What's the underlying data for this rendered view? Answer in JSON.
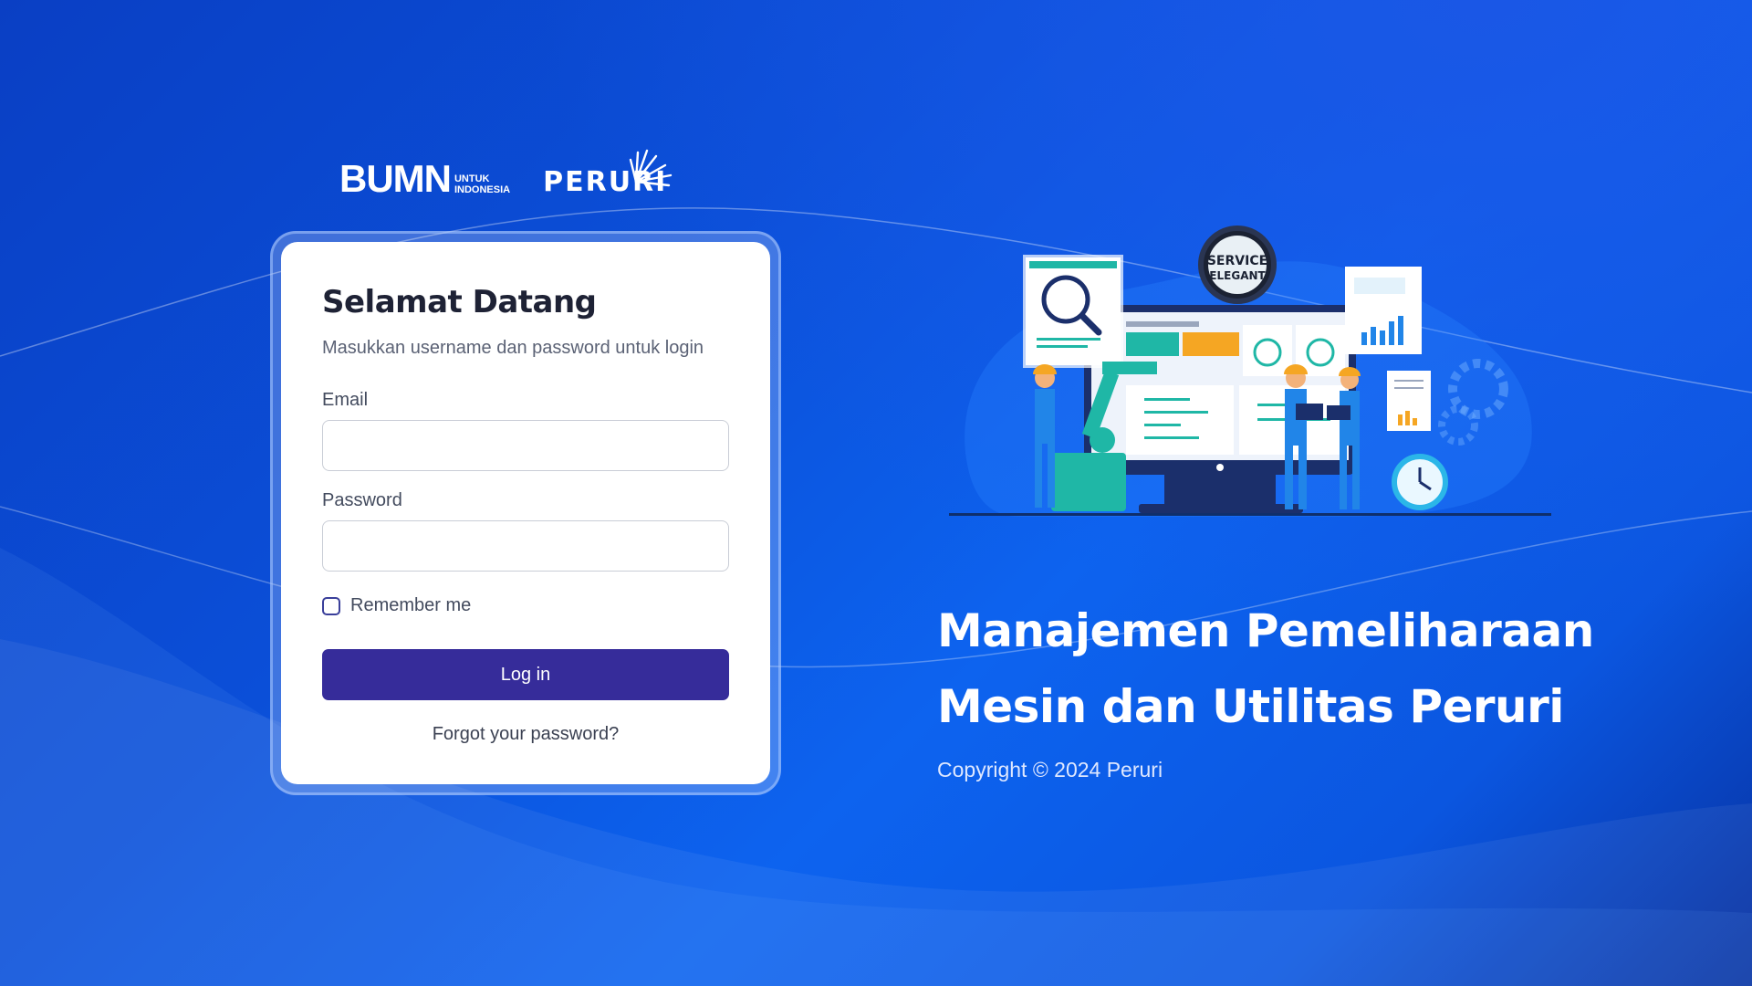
{
  "brand": {
    "bumn_logo": "BUMN",
    "bumn_sub_line1": "UNTUK",
    "bumn_sub_line2": "INDONESIA",
    "peruri_logo": "PERURI"
  },
  "login": {
    "title": "Selamat Datang",
    "subtitle": "Masukkan username dan password untuk login",
    "email_label": "Email",
    "email_value": "",
    "password_label": "Password",
    "password_value": "",
    "remember_label": "Remember me",
    "remember_checked": false,
    "login_button": "Log in",
    "forgot_link": "Forgot your password?"
  },
  "hero": {
    "headline_line1": "Manajemen Pemeliharaan",
    "headline_line2": "Mesin dan Utilitas Peruri",
    "copyright": "Copyright © 2024 Peruri",
    "badge_line1": "SERVICE",
    "badge_line2": "ELEGANT"
  },
  "colors": {
    "primary_button": "#362c9a",
    "background": "#0b4fd8",
    "accent_teal": "#1fb7a6",
    "accent_orange": "#f5a623"
  }
}
